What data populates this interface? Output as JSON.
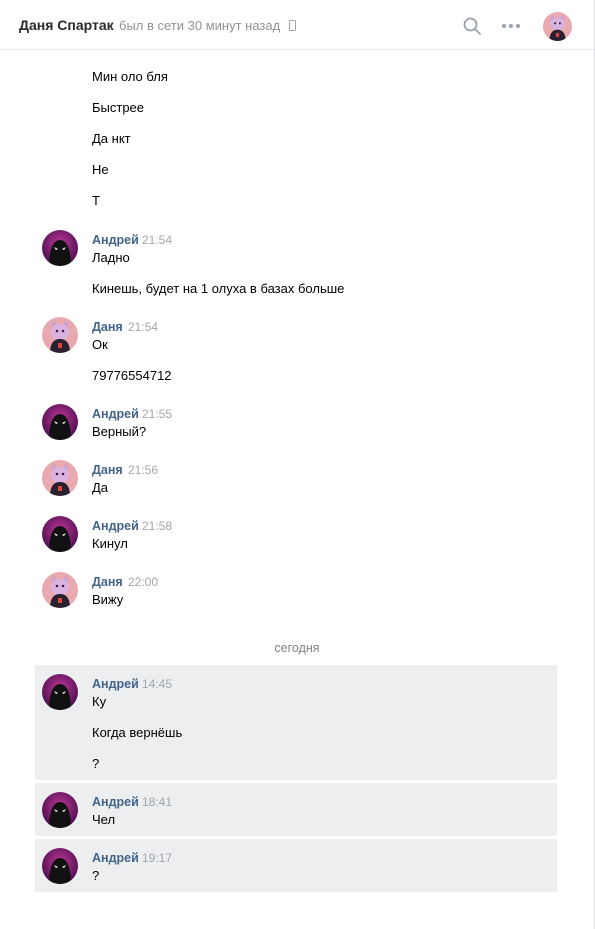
{
  "header": {
    "name": "Даня Спартак",
    "status": "был в сети 30 минут назад"
  },
  "messages": {
    "first_group": [
      "Мин оло бля",
      "Быстрее",
      "Да нкт",
      "Не",
      "Т"
    ],
    "g1": {
      "author": "Андрей",
      "time": "21:54",
      "lines": [
        "Ладно",
        "Кинешь, будет на 1 олуха в базах больше"
      ]
    },
    "g2": {
      "author": "Даня",
      "time": "21:54",
      "lines": [
        "Ок",
        "79776554712"
      ]
    },
    "g3": {
      "author": "Андрей",
      "time": "21:55",
      "lines": [
        "Верный?"
      ]
    },
    "g4": {
      "author": "Даня",
      "time": "21:56",
      "lines": [
        "Да"
      ]
    },
    "g5": {
      "author": "Андрей",
      "time": "21:58",
      "lines": [
        "Кинул"
      ]
    },
    "g6": {
      "author": "Даня",
      "time": "22:00",
      "lines": [
        "Вижу"
      ]
    },
    "date_separator": "сегодня",
    "g7": {
      "author": "Андрей",
      "time": "14:45",
      "lines": [
        "Ку",
        "Когда вернёшь",
        "?"
      ]
    },
    "g8": {
      "author": "Андрей",
      "time": "18:41",
      "lines": [
        "Чел"
      ]
    },
    "g9": {
      "author": "Андрей",
      "time": "19:17",
      "lines": [
        "?"
      ]
    }
  },
  "icons": {
    "search": "search-icon",
    "more": "more-icon",
    "phone": "phone-icon"
  },
  "colors": {
    "author_link": "#42648b",
    "unread_background": "#edeef0",
    "time": "#a0a6ad"
  }
}
